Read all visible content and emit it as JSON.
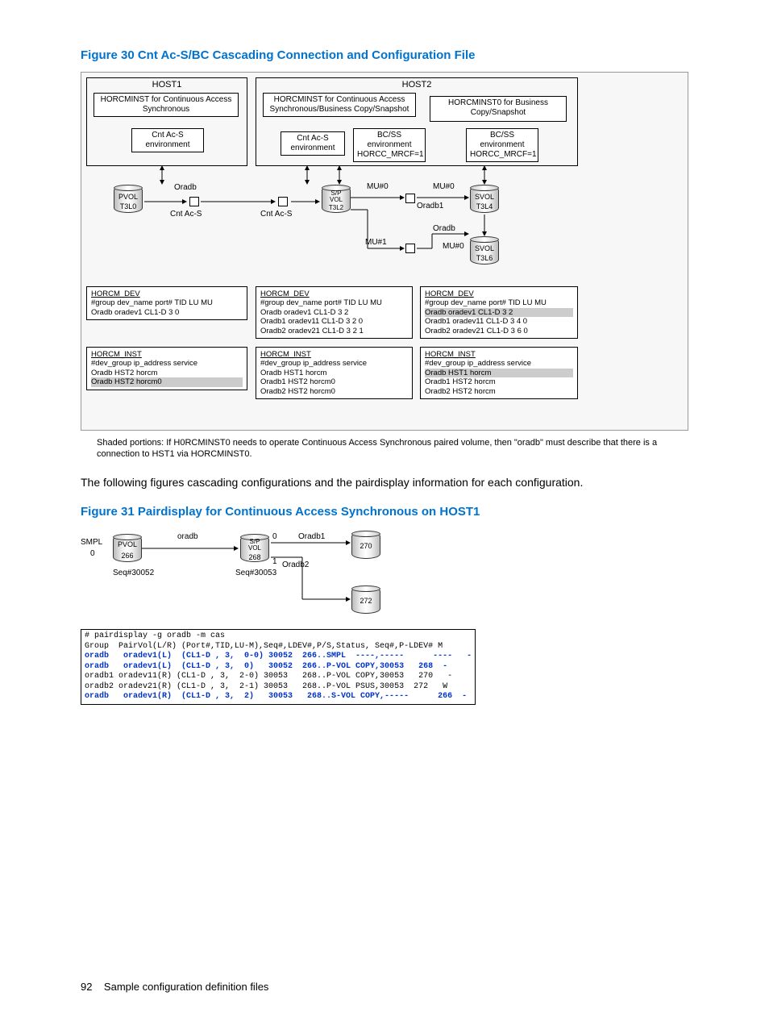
{
  "fig30": {
    "title": "Figure 30 Cnt Ac-S/BC Cascading Connection and Configuration File",
    "host1": "HOST1",
    "host2": "HOST2",
    "horcm1": "HORCMINST for Continuous Access Synchronous",
    "horcm2": "HORCMINST for Continuous Access Synchronous/Business Copy/Snapshot",
    "horcm3": "HORCMINST0 for Business Copy/Snapshot",
    "env1": "Cnt Ac-S environment",
    "env2": "Cnt Ac-S environment",
    "env3": "BC/SS environment HORCC_MRCF=1",
    "env4": "BC/SS environment HORCC_MRCF=1",
    "pvol": "PVOL",
    "t3l0": "T3L0",
    "t3l2": "T3L2",
    "t3l4": "T3L4",
    "t3l6": "T3L6",
    "spvol": "S/P VOL",
    "svol": "SVOL",
    "oradb": "Oradb",
    "oradb1": "Oradb1",
    "cntacs": "Cnt Ac-S",
    "mu0": "MU#0",
    "mu1": "MU#1",
    "dev1": {
      "h": "HORCM_DEV",
      "r1": "#group dev_name port# TID LU MU",
      "r2": "Oradb  oradev1  CL1-D  3  0"
    },
    "dev2": {
      "h": "HORCM_DEV",
      "r1": "#group dev_name port# TID LU MU",
      "r2": "Oradb   oradev1  CL1-D  3  2",
      "r3": "Oradb1 oradev11 CL1-D  3  2   0",
      "r4": "Oradb2 oradev21 CL1-D  3  2   1"
    },
    "dev3": {
      "h": "HORCM_DEV",
      "r1": "#group dev_name port# TID LU MU",
      "r2": "Oradb  oradev1  CL1-D  3  2",
      "r3": "Oradb1 oradev11 CL1-D   3  4   0",
      "r4": "Oradb2 oradev21 CL1-D  3  6   0"
    },
    "inst1": {
      "h": "HORCM_INST",
      "r1": "#dev_group    ip_address    service",
      "r2": "Oradb            HST2              horcm",
      "r3": "Oradb            HST2              horcm0"
    },
    "inst2": {
      "h": "HORCM_INST",
      "r1": "#dev_group    ip_address    service",
      "r2": "Oradb            HST1              horcm",
      "r3": "Oradb1          HST2              horcm0",
      "r4": "Oradb2          HST2              horcm0"
    },
    "inst3": {
      "h": "HORCM_INST",
      "r1": "#dev_group    ip_address    service",
      "r2": "Oradb            HST1              horcm",
      "r3": "Oradb1          HST2              horcm",
      "r4": "Oradb2          HST2              horcm"
    },
    "caption": "Shaded portions: If H0RCMINST0 needs to operate Continuous Access Synchronous paired volume, then \"oradb\" must describe that there is a connection to HST1 via HORCMINST0."
  },
  "body1": "The following figures cascading configurations and the pairdisplay information for each configuration.",
  "fig31": {
    "title": "Figure 31 Pairdisplay for Continuous Access Synchronous on HOST1",
    "smpl": "SMPL",
    "zero": "0",
    "one": "1",
    "pvol": "PVOL",
    "v266": "266",
    "v268": "268",
    "v270": "270",
    "v272": "272",
    "spvol": "S/P VOL",
    "seq1": "Seq#30052",
    "seq2": "Seq#30053",
    "oradb": "oradb",
    "oradb1": "Oradb1",
    "oradb2": "Oradb2",
    "cmd": "# pairdisplay -g oradb -m cas\nGroup  PairVol(L/R) (Port#,TID,LU-M),Seq#,LDEV#,P/S,Status, Seq#,P-LDEV# M",
    "row1": "oradb   oradev1(L)  (CL1-D , 3,  0-0) 30052  266..SMPL  ----,-----      ----   -",
    "row2": "oradb   oradev1(L)  (CL1-D , 3,  0)   30052  266..P-VOL COPY,30053   268  -",
    "row3": "oradb1 oradev11(R) (CL1-D , 3,  2-0) 30053   268..P-VOL COPY,30053   270   -",
    "row4": "oradb2 oradev21(R) (CL1-D , 3,  2-1) 30053   268..P-VOL PSUS,30053  272   W",
    "row5": "oradb   oradev1(R)  (CL1-D , 3,  2)   30053   268..S-VOL COPY,-----      266  -"
  },
  "footer": {
    "page": "92",
    "section": "Sample configuration definition files"
  }
}
